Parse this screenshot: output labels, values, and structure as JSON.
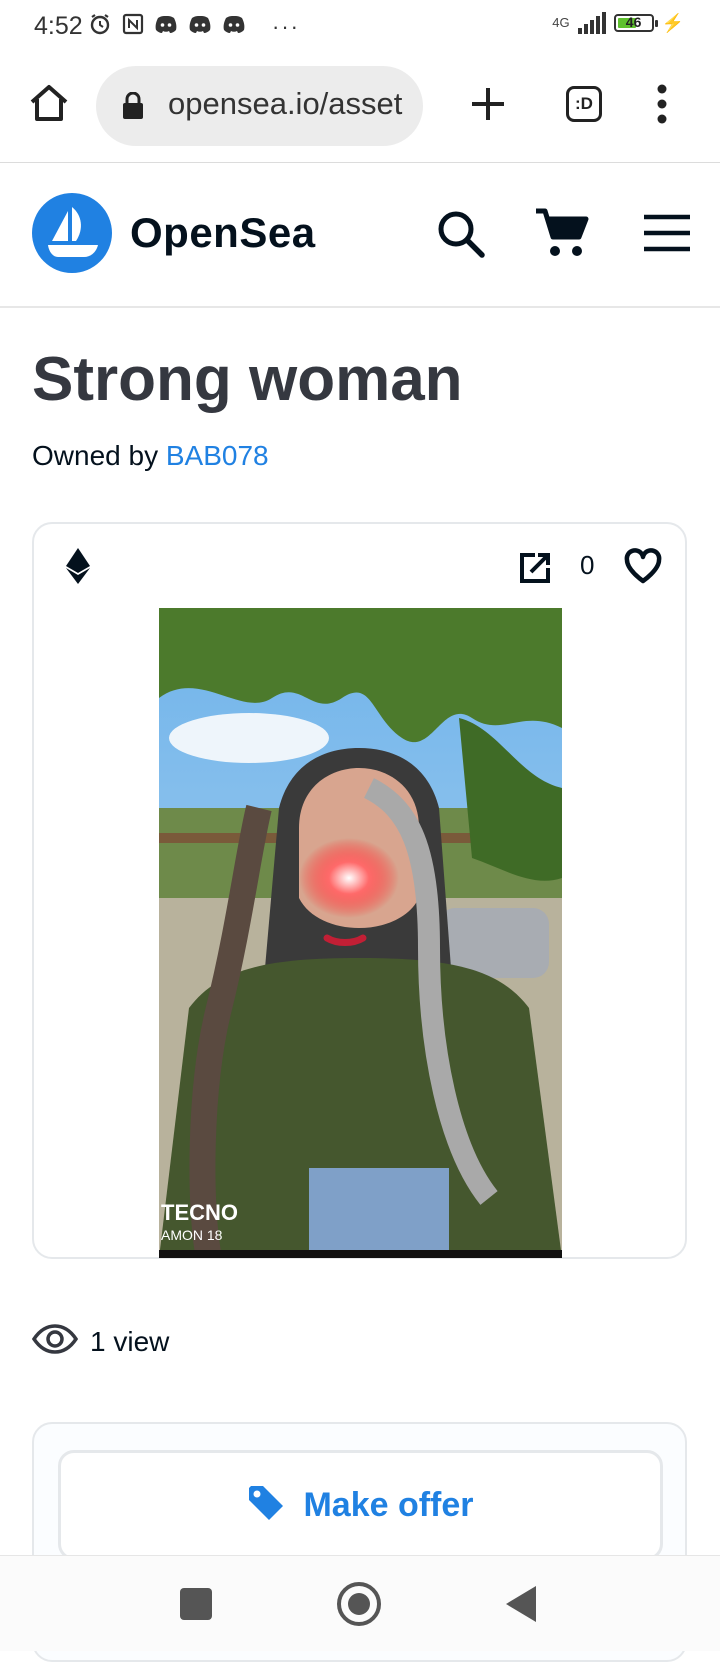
{
  "status_bar": {
    "time": "4:52",
    "network": "4G",
    "battery": "46",
    "more_indicator": "···"
  },
  "browser": {
    "url": "opensea.io/asset",
    "tabs_label": ":D"
  },
  "site": {
    "name": "OpenSea",
    "brand_color": "#2081e2"
  },
  "asset": {
    "title": "Strong woman",
    "owned_by_prefix": "Owned by",
    "owner": "BAB078",
    "favorites_count": "0",
    "image_watermark_line1": "TECNO",
    "image_watermark_line2": "AMON 18",
    "views_label": "1 view"
  },
  "actions": {
    "make_offer_label": "Make offer"
  },
  "icons": [
    "home-icon",
    "lock-icon",
    "plus-icon",
    "tabs-icon",
    "more-vert-icon",
    "opensea-logo-icon",
    "search-icon",
    "cart-icon",
    "menu-icon",
    "ethereum-icon",
    "external-link-icon",
    "heart-icon",
    "eye-icon",
    "tag-icon"
  ]
}
